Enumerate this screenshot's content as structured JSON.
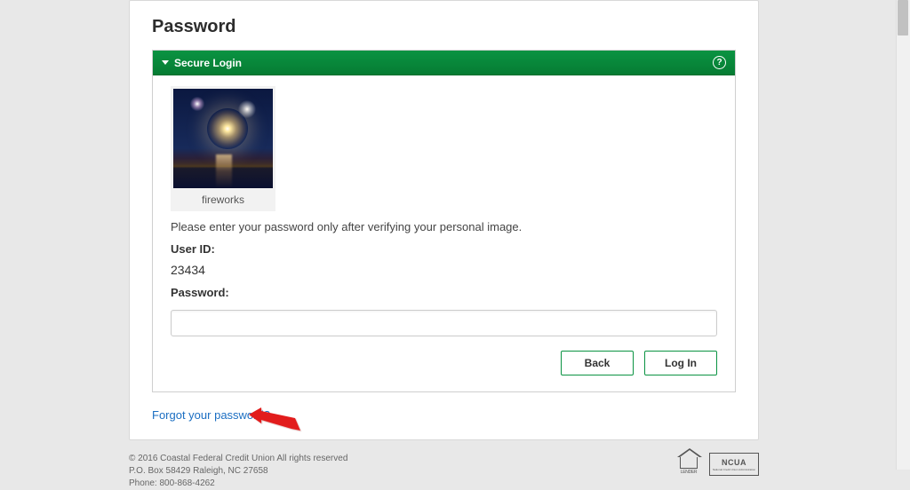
{
  "page": {
    "title": "Password"
  },
  "panel": {
    "header": "Secure Login"
  },
  "security": {
    "image_name": "fireworks-image",
    "caption": "fireworks"
  },
  "form": {
    "instruction": "Please enter your password only after verifying your personal image.",
    "user_id_label": "User ID:",
    "user_id_value": "23434",
    "password_label": "Password:"
  },
  "buttons": {
    "back": "Back",
    "login": "Log In"
  },
  "links": {
    "forgot_password": "Forgot your password?"
  },
  "footer": {
    "copyright": "© 2016 Coastal Federal Credit Union All rights reserved",
    "address": "P.O. Box 58429 Raleigh, NC 27658",
    "phone": "Phone: 800-868-4262",
    "lender_label": "LENDER",
    "ncua_label": "NCUA"
  }
}
